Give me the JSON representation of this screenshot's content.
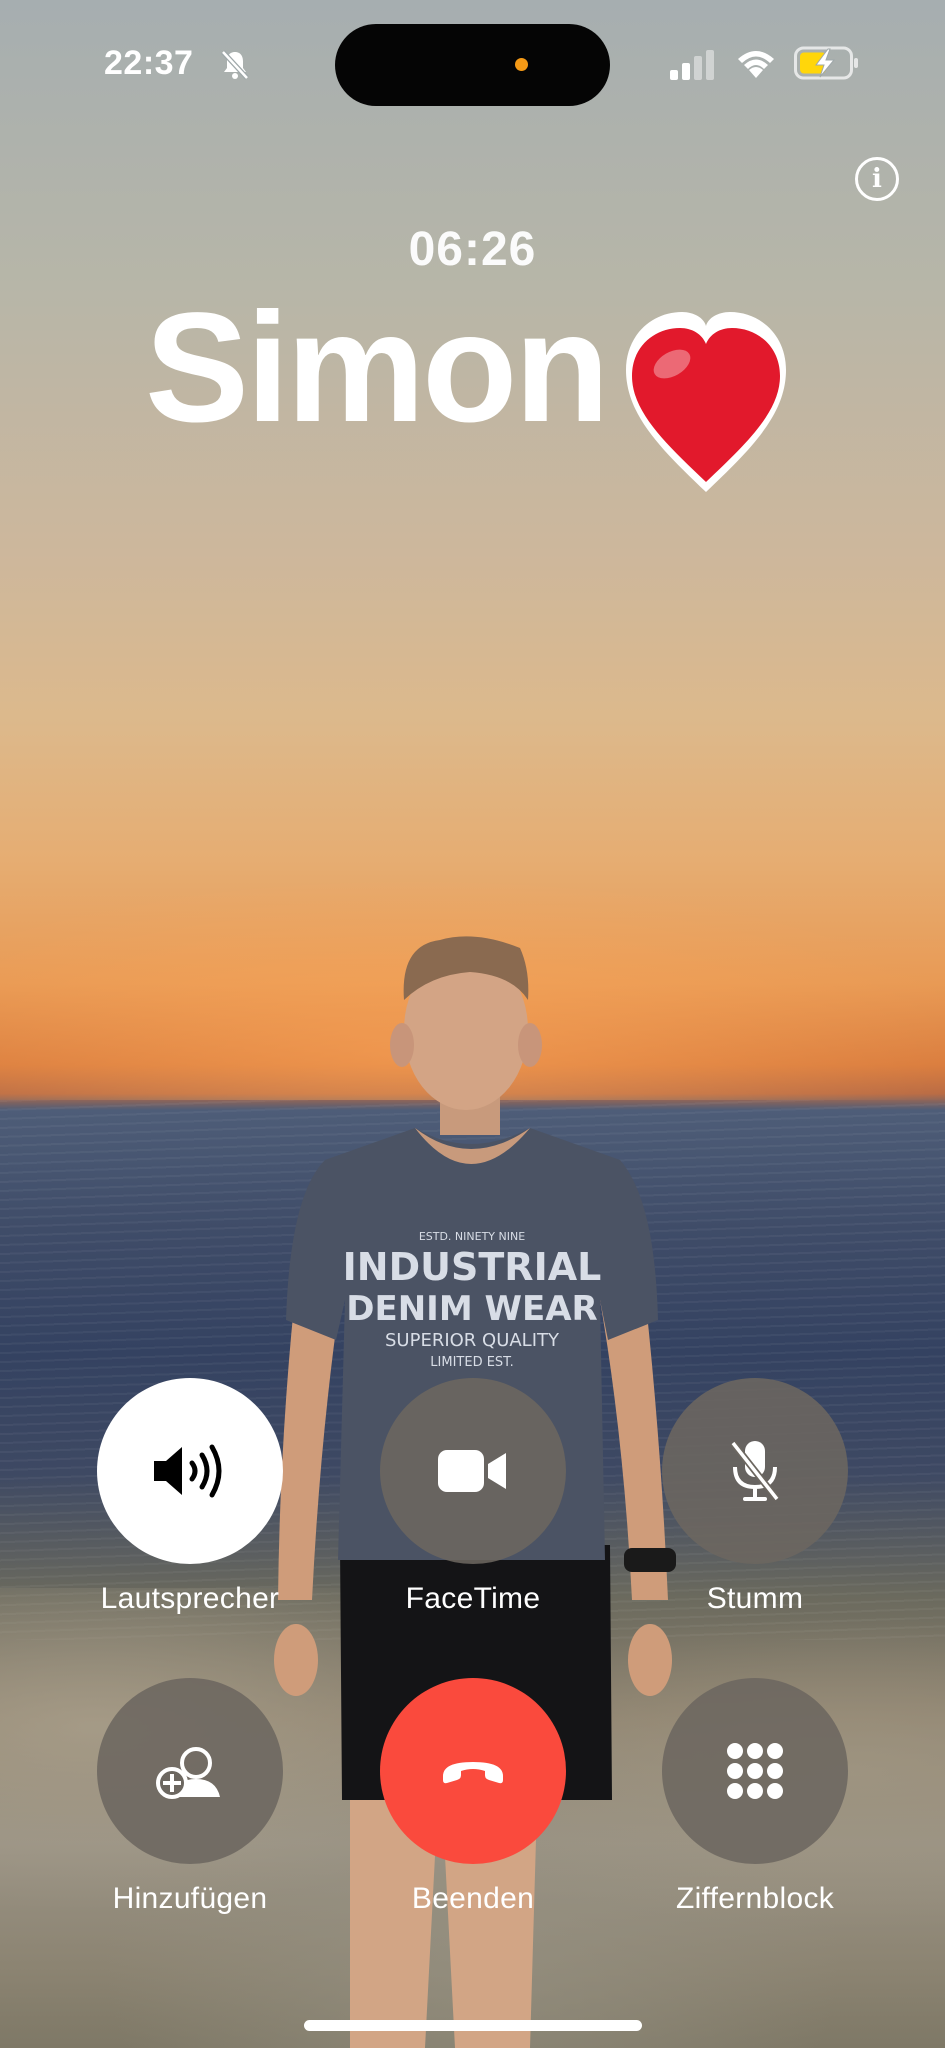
{
  "status_bar": {
    "time": "22:37",
    "silent_icon": "bell-slash-icon",
    "signal_icon": "cellular-signal-icon",
    "wifi_icon": "wifi-icon",
    "battery_icon": "battery-charging-icon",
    "battery_color": "#ffd60a"
  },
  "dynamic_island": {
    "indicator_color": "#f59a16"
  },
  "call": {
    "duration": "06:26",
    "caller_name": "Simon",
    "caller_emoji_icon": "red-heart-icon",
    "info_glyph": "i"
  },
  "controls": {
    "speaker": {
      "label": "Lautsprecher",
      "icon": "speaker-wave-icon",
      "active": true
    },
    "facetime": {
      "label": "FaceTime",
      "icon": "video-camera-icon"
    },
    "mute": {
      "label": "Stumm",
      "icon": "microphone-slash-icon"
    },
    "add": {
      "label": "Hinzufügen",
      "icon": "add-person-icon"
    },
    "end": {
      "label": "Beenden",
      "icon": "phone-hangup-icon",
      "color": "#fa4a3d"
    },
    "keypad": {
      "label": "Ziffernblock",
      "icon": "keypad-icon"
    }
  }
}
